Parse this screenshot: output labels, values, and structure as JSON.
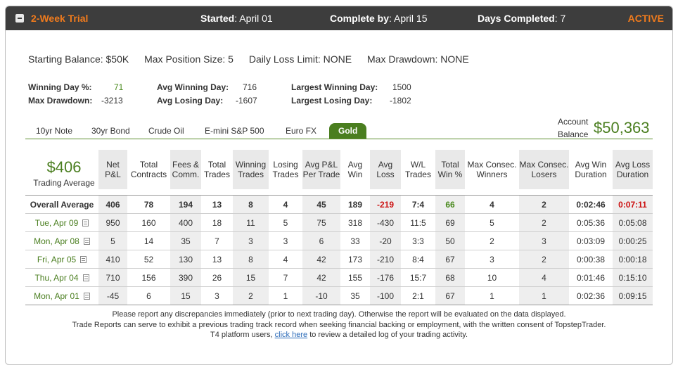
{
  "header": {
    "title": "2-Week Trial",
    "started_label": "Started",
    "started_value": ": April 01",
    "complete_label": "Complete by",
    "complete_value": ": April 15",
    "days_label": "Days Completed",
    "days_value": ": 7",
    "status": "ACTIVE"
  },
  "rules": {
    "starting_balance": "Starting Balance: $50K",
    "max_position": "Max Position Size: 5",
    "daily_loss": "Daily Loss Limit: NONE",
    "max_drawdown": "Max Drawdown: NONE"
  },
  "stats": {
    "winning_day_pct_label": "Winning Day %:",
    "winning_day_pct": "71",
    "max_drawdown_label": "Max Drawdown:",
    "max_drawdown": "-3213",
    "avg_winning_day_label": "Avg Winning Day:",
    "avg_winning_day": "716",
    "avg_losing_day_label": "Avg Losing Day:",
    "avg_losing_day": "-1607",
    "largest_winning_day_label": "Largest Winning Day:",
    "largest_winning_day": "1500",
    "largest_losing_day_label": "Largest Losing Day:",
    "largest_losing_day": "-1802"
  },
  "tabs": [
    "10yr Note",
    "30yr Bond",
    "Crude Oil",
    "E-mini S&P 500",
    "Euro FX",
    "Gold"
  ],
  "active_tab": "Gold",
  "account": {
    "label_line1": "Account",
    "label_line2": "Balance",
    "value": "$50,363"
  },
  "summary": {
    "value": "$406",
    "label": "Trading Average"
  },
  "columns": [
    "Net P&L",
    "Total Contracts",
    "Fees & Comm.",
    "Total Trades",
    "Winning Trades",
    "Losing Trades",
    "Avg P&L Per Trade",
    "Avg Win",
    "Avg Loss",
    "W/L Trades",
    "Total Win %",
    "Max Consec. Winners",
    "Max Consec. Losers",
    "Avg Win Duration",
    "Avg Loss Duration"
  ],
  "overall": {
    "label": "Overall Average",
    "values": [
      "406",
      "78",
      "194",
      "13",
      "8",
      "4",
      "45",
      "189",
      "-219",
      "7:4",
      "66",
      "4",
      "2",
      "0:02:46",
      "0:07:11"
    ]
  },
  "rows": [
    {
      "date": "Tue, Apr 09",
      "values": [
        "950",
        "160",
        "400",
        "18",
        "11",
        "5",
        "75",
        "318",
        "-430",
        "11:5",
        "69",
        "5",
        "2",
        "0:05:36",
        "0:05:08"
      ]
    },
    {
      "date": "Mon, Apr 08",
      "values": [
        "5",
        "14",
        "35",
        "7",
        "3",
        "3",
        "6",
        "33",
        "-20",
        "3:3",
        "50",
        "2",
        "3",
        "0:03:09",
        "0:00:25"
      ]
    },
    {
      "date": "Fri, Apr 05",
      "values": [
        "410",
        "52",
        "130",
        "13",
        "8",
        "4",
        "42",
        "173",
        "-210",
        "8:4",
        "67",
        "3",
        "2",
        "0:00:38",
        "0:00:18"
      ]
    },
    {
      "date": "Thu, Apr 04",
      "values": [
        "710",
        "156",
        "390",
        "26",
        "15",
        "7",
        "42",
        "155",
        "-176",
        "15:7",
        "68",
        "10",
        "4",
        "0:01:46",
        "0:15:10"
      ]
    },
    {
      "date": "Mon, Apr 01",
      "values": [
        "-45",
        "6",
        "15",
        "3",
        "2",
        "1",
        "-10",
        "35",
        "-100",
        "2:1",
        "67",
        "1",
        "1",
        "0:02:36",
        "0:09:15"
      ]
    }
  ],
  "footer": {
    "line1": "Please report any discrepancies immediately (prior to next trading day). Otherwise the report will be evaluated on the data displayed.",
    "line2": "Trade Reports can serve to exhibit a previous trading track record when seeking financial backing or employment, with the written consent of TopstepTrader.",
    "line3_prefix": "T4 platform users,",
    "line3_link": "click here",
    "line3_suffix": "to review a detailed log of your trading activity."
  },
  "colors": {
    "accent_orange": "#f07b1d",
    "green": "#4a7e1f",
    "red": "#cc1111",
    "header_bg": "#3d3d3d"
  }
}
